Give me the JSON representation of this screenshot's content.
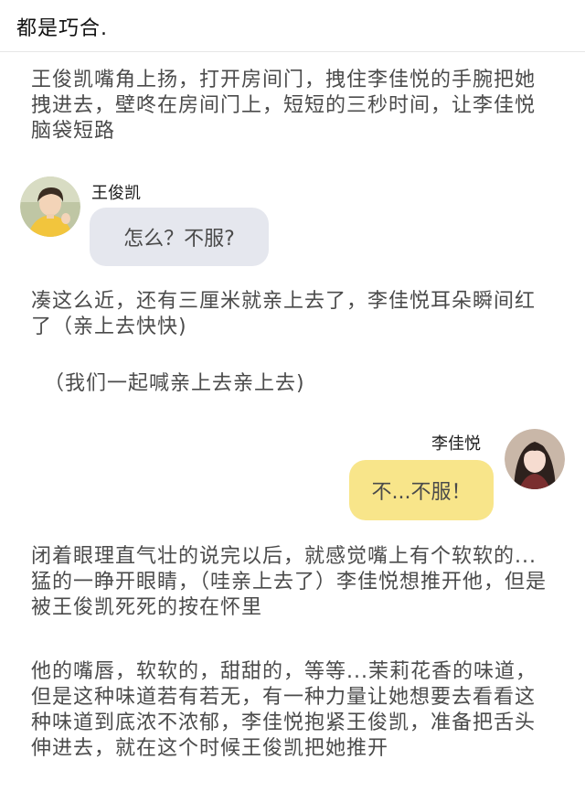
{
  "header": {
    "title": "都是巧合."
  },
  "paragraphs": {
    "p1": "王俊凯嘴角上扬，打开房间门，拽住李佳悦的手腕把她拽进去，壁咚在房间门上，短短的三秒时间，让李佳悦脑袋短路",
    "p2": "凑这么近，还有三厘米就亲上去了，李佳悦耳朵瞬间红了（亲上去快快)",
    "p3": "（我们一起喊亲上去亲上去)",
    "p4": "闭着眼理直气壮的说完以后，就感觉嘴上有个软软的...猛的一睁开眼睛，（哇亲上去了）李佳悦想推开他，但是被王俊凯死死的按在怀里",
    "p5": "他的嘴唇，软软的，甜甜的，等等...茉莉花香的味道，但是这种味道若有若无，有一种力量让她想要去看看这种味道到底浓不浓郁，李佳悦抱紧王俊凯，准备把舌头伸进去，就在这个时候王俊凯把她推开"
  },
  "chat": {
    "left": {
      "name": "王俊凯",
      "message": "怎么？不服?",
      "bubble_color": "#e5e7ee"
    },
    "right": {
      "name": "李佳悦",
      "message": "不...不服！",
      "bubble_color": "#f8e58a"
    }
  },
  "colors": {
    "text": "#4b4b4b",
    "title": "#111111"
  },
  "icons": {
    "left_avatar": "avatar-boy-yellow-shirt",
    "right_avatar": "avatar-girl-dark-hair"
  }
}
